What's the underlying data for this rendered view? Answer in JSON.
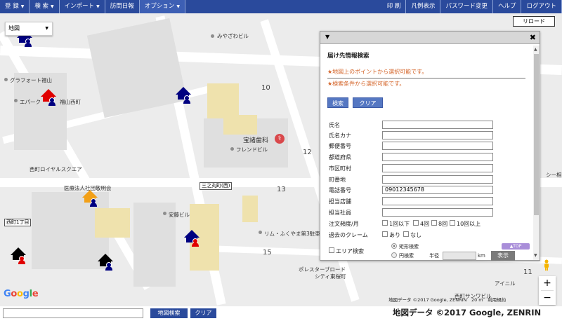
{
  "topnav": {
    "left_items": [
      "登 録",
      "検 索",
      "インポート",
      "訪問日報",
      "オプション"
    ],
    "right_items": [
      "印 刷",
      "凡例表示",
      "パスワード変更",
      "ヘルプ",
      "ログアウト"
    ]
  },
  "map": {
    "type_select": "地図",
    "reload_label": "リロード",
    "labels": {
      "miyazawa": "みやざわビル",
      "graphfort": "グラフォート福山",
      "epark": "エパーク",
      "fukuyama_nishi": "福山西町",
      "houen": "宝諸歯科",
      "friend": "フレンドビル",
      "royal": "西町ロイヤルスクエア",
      "iryou": "医療法人社団敬明会",
      "sannomaru": "三之丸町(西)",
      "nishimachi1": "西町1丁目",
      "annou": "安藤ビル",
      "rim": "リム・ふくやま第3駐車場",
      "polestar": "ポレスターブロード",
      "city": "シティ東桜町",
      "nishi_sangyo": "西町サンワビル",
      "ainiru": "アイニル",
      "shi": "シー相"
    },
    "block_numbers": [
      "10",
      "12",
      "13",
      "15",
      "11"
    ],
    "footer": "地図データ ©2017 Google, ZENRIN　20 m　利用規約",
    "google": "Google"
  },
  "panel": {
    "title": "届け先情報検索",
    "note1": "★地図上のポイントから選択可能です。",
    "note2": "★検索条件から選択可能です。",
    "search_btn": "検索",
    "clear_btn": "クリア",
    "fields": [
      {
        "label": "氏名",
        "value": ""
      },
      {
        "label": "氏名カナ",
        "value": ""
      },
      {
        "label": "郵便番号",
        "value": ""
      },
      {
        "label": "都道府県",
        "value": ""
      },
      {
        "label": "市区町村",
        "value": ""
      },
      {
        "label": "町番地",
        "value": ""
      },
      {
        "label": "電話番号",
        "value": "09012345678"
      },
      {
        "label": "担当店舗",
        "value": ""
      },
      {
        "label": "担当社員",
        "value": ""
      }
    ],
    "order_freq_label": "注文頻度/月",
    "order_freq_options": [
      "1回以下",
      "4回",
      "8回",
      "10回以上"
    ],
    "claim_label": "過去のクレーム",
    "claim_options": [
      "あり",
      "なし"
    ],
    "area_label": "エリア検索",
    "rect_label": "矩形検索",
    "circle_label": "円検索",
    "radius_label": "半径",
    "km_label": "km",
    "show_btn": "表示",
    "top_btn": "▲TOP"
  },
  "bottom": {
    "address_value": "",
    "map_search_btn": "地図検索",
    "clear_btn": "クリア",
    "copyright": "地図データ ©2017 Google, ZENRIN"
  },
  "colors": {
    "nav": "#2a4a9c",
    "accent_orange": "#d4652a",
    "house_navy": "#000080",
    "house_red": "#e00000"
  }
}
